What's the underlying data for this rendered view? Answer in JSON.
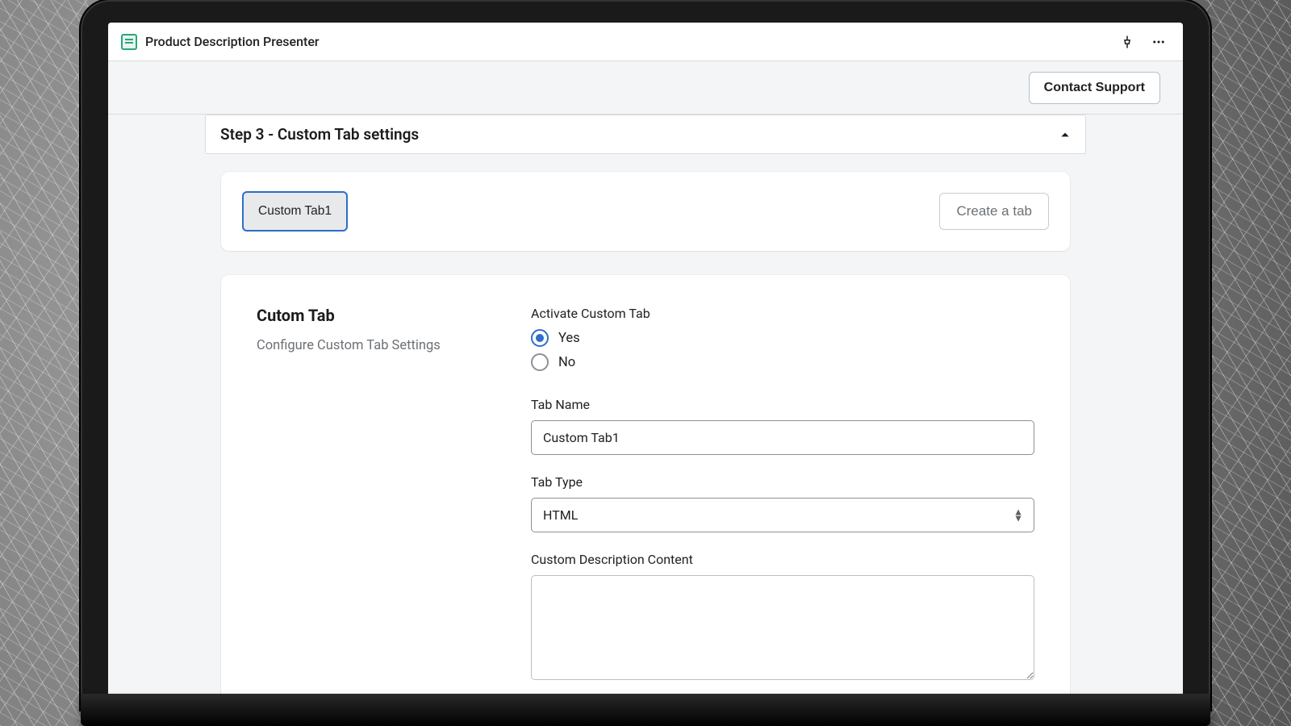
{
  "titlebar": {
    "app_title": "Product Description Presenter"
  },
  "actionbar": {
    "contact_support_label": "Contact Support"
  },
  "accordion": {
    "title": "Step 3 - Custom Tab settings"
  },
  "tabs_card": {
    "tab_chip_label": "Custom Tab1",
    "create_tab_label": "Create a tab"
  },
  "settings": {
    "heading": "Cutom Tab",
    "subheading": "Configure Custom Tab Settings",
    "activate_label": "Activate Custom Tab",
    "radio_yes": "Yes",
    "radio_no": "No",
    "activate_value": "yes",
    "tab_name_label": "Tab Name",
    "tab_name_value": "Custom Tab1",
    "tab_type_label": "Tab Type",
    "tab_type_value": "HTML",
    "custom_desc_label": "Custom Description Content",
    "custom_desc_value": ""
  }
}
